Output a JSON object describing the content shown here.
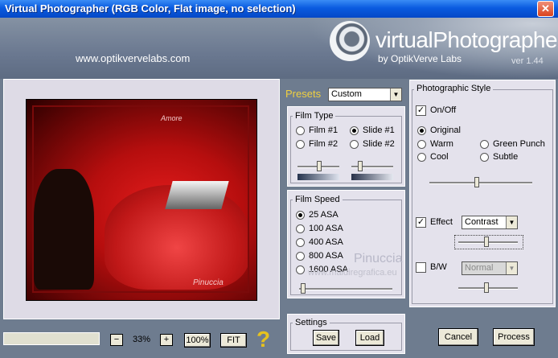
{
  "window": {
    "title": "Virtual Photographer (RGB Color, Flat image, no selection)",
    "close_glyph": "✕"
  },
  "header": {
    "url": "www.optikvervelabs.com",
    "brand": "virtualPhotographer",
    "byline": "by OptikVerve Labs",
    "version": "ver 1.44"
  },
  "preview": {
    "overlay_text1": "Amore",
    "overlay_text2": "Pinuccia"
  },
  "zoom": {
    "minus": "−",
    "value": "33%",
    "plus": "+",
    "hundred": "100%",
    "fit": "FIT",
    "help": "?"
  },
  "presets": {
    "label": "Presets",
    "value": "Custom"
  },
  "film_type": {
    "title": "Film Type",
    "options": [
      "Film #1",
      "Film #2",
      "Slide #1",
      "Slide #2"
    ],
    "selected": "Slide #1"
  },
  "film_speed": {
    "title": "Film Speed",
    "options": [
      "25 ASA",
      "100 ASA",
      "400 ASA",
      "800 ASA",
      "1600 ASA"
    ],
    "selected": "25 ASA"
  },
  "settings": {
    "title": "Settings",
    "save": "Save",
    "load": "Load"
  },
  "style": {
    "title": "Photographic Style",
    "onoff_label": "On/Off",
    "onoff_checked": true,
    "options": [
      "Original",
      "Warm",
      "Cool",
      "Green Punch",
      "Subtle"
    ],
    "selected": "Original",
    "effect_label": "Effect",
    "effect_checked": true,
    "effect_value": "Contrast",
    "bw_label": "B/W",
    "bw_checked": false,
    "bw_value": "Normal"
  },
  "watermark": {
    "line1": "Pinuccia",
    "line2": "www.maldiregrafica.eu"
  },
  "actions": {
    "cancel": "Cancel",
    "process": "Process"
  },
  "colors": {
    "title_bar": "#0a5be0",
    "preset_label": "#f0d040",
    "panel_bg": "#e4e2ec",
    "header_bg": "#6a7890"
  }
}
